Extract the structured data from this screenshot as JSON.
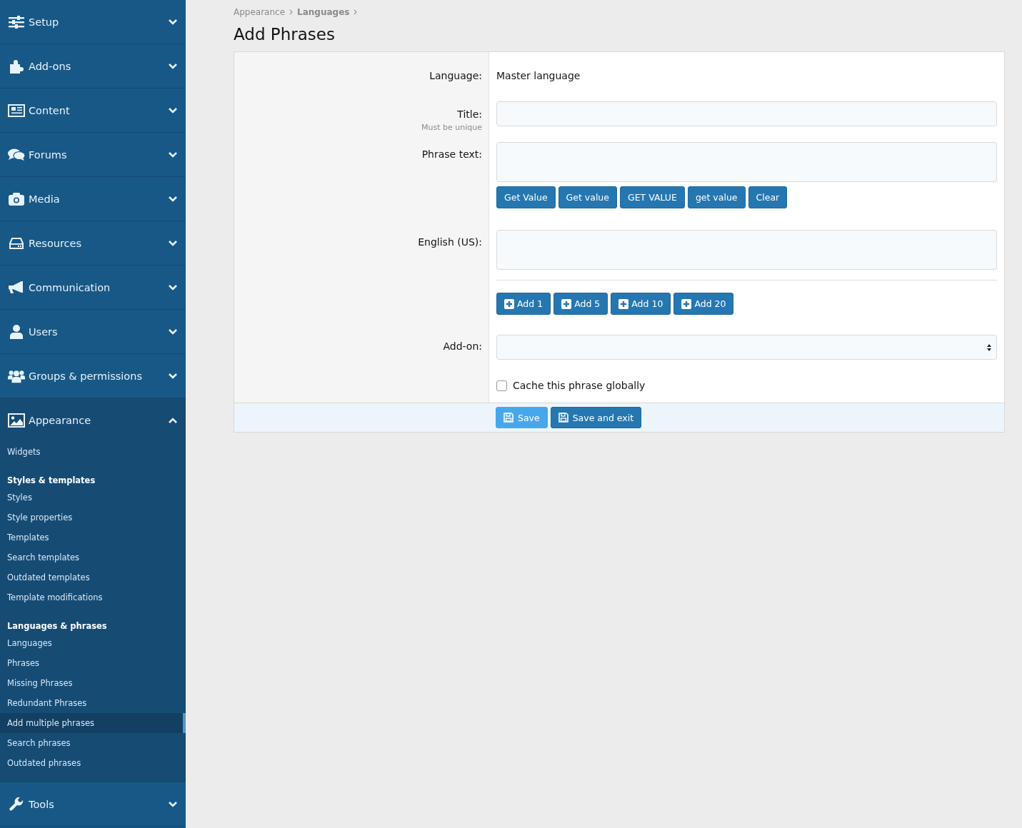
{
  "sidebar": {
    "sections": [
      {
        "label": "Setup",
        "expanded": false
      },
      {
        "label": "Add-ons",
        "expanded": false
      },
      {
        "label": "Content",
        "expanded": false
      },
      {
        "label": "Forums",
        "expanded": false
      },
      {
        "label": "Media",
        "expanded": false
      },
      {
        "label": "Resources",
        "expanded": false
      },
      {
        "label": "Communication",
        "expanded": false
      },
      {
        "label": "Users",
        "expanded": false
      },
      {
        "label": "Groups & permissions",
        "expanded": false
      },
      {
        "label": "Appearance",
        "expanded": true,
        "items": [
          {
            "kind": "link",
            "label": "Widgets",
            "selected": false
          },
          {
            "kind": "heading",
            "label": "Styles & templates"
          },
          {
            "kind": "link",
            "label": "Styles",
            "selected": false
          },
          {
            "kind": "link",
            "label": "Style properties",
            "selected": false
          },
          {
            "kind": "link",
            "label": "Templates",
            "selected": false
          },
          {
            "kind": "link",
            "label": "Search templates",
            "selected": false
          },
          {
            "kind": "link",
            "label": "Outdated templates",
            "selected": false
          },
          {
            "kind": "link",
            "label": "Template modifications",
            "selected": false
          },
          {
            "kind": "heading",
            "label": "Languages & phrases"
          },
          {
            "kind": "link",
            "label": "Languages",
            "selected": false
          },
          {
            "kind": "link",
            "label": "Phrases",
            "selected": false
          },
          {
            "kind": "link",
            "label": "Missing Phrases",
            "selected": false
          },
          {
            "kind": "link",
            "label": "Redundant Phrases",
            "selected": false
          },
          {
            "kind": "link",
            "label": "Add multiple phrases",
            "selected": true
          },
          {
            "kind": "link",
            "label": "Search phrases",
            "selected": false
          },
          {
            "kind": "link",
            "label": "Outdated phrases",
            "selected": false
          }
        ]
      },
      {
        "label": "Tools",
        "expanded": false
      }
    ]
  },
  "breadcrumb": [
    "Appearance",
    "Languages"
  ],
  "page_title": "Add Phrases",
  "form": {
    "rows": [
      {
        "kind": "value",
        "label": "Language:",
        "value": "Master language"
      },
      {
        "kind": "input",
        "label": "Title:",
        "hint": "Must be unique"
      },
      {
        "kind": "textarea",
        "label": "Phrase text:",
        "buttons": [
          "Get Value",
          "Get value",
          "GET VALUE",
          "get value",
          "Clear"
        ]
      },
      {
        "kind": "textarea",
        "label": "English (US):"
      },
      {
        "kind": "divider"
      },
      {
        "kind": "add-buttons",
        "buttons": [
          "Add 1",
          "Add 5",
          "Add 10",
          "Add 20"
        ]
      },
      {
        "kind": "select",
        "label": "Add-on:"
      },
      {
        "kind": "checkbox",
        "label": "Cache this phrase globally",
        "checked": false
      }
    ],
    "footer_buttons": [
      {
        "label": "Save",
        "kind": "primary"
      },
      {
        "label": "Save and exit",
        "kind": "secondary"
      }
    ]
  }
}
